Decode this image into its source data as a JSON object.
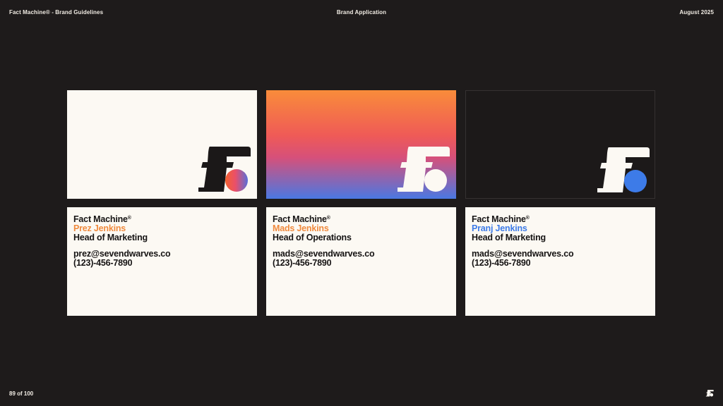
{
  "header": {
    "left": "Fact Machine® - Brand Guidelines",
    "center": "Brand Application",
    "right": "August 2025"
  },
  "footer": {
    "page": "89 of 100",
    "logo_icon": "fact-machine-logo-icon"
  },
  "colors": {
    "background": "#1e1b1b",
    "card_light": "#fcf9f3",
    "orange": "#f08a3e",
    "blue": "#3d7be8",
    "ink": "#151313"
  },
  "cards": [
    {
      "variant": "light",
      "brand": "Fact Machine",
      "brand_mark": "®",
      "name": "Prez Jenkins",
      "name_color": "#f08a3e",
      "role": "Head of Marketing",
      "email": "prez@sevendwarves.co",
      "phone": "(123)-456-7890"
    },
    {
      "variant": "gradient",
      "brand": "Fact Machine",
      "brand_mark": "®",
      "name": "Mads Jenkins",
      "name_color": "#f08a3e",
      "role": "Head of Operations",
      "email": "mads@sevendwarves.co",
      "phone": "(123)-456-7890"
    },
    {
      "variant": "dark",
      "brand": "Fact Machine",
      "brand_mark": "®",
      "name": "Pranj Jenkins",
      "name_color": "#3d7be8",
      "role": "Head of Marketing",
      "email": "mads@sevendwarves.co",
      "phone": "(123)-456-7890"
    }
  ]
}
